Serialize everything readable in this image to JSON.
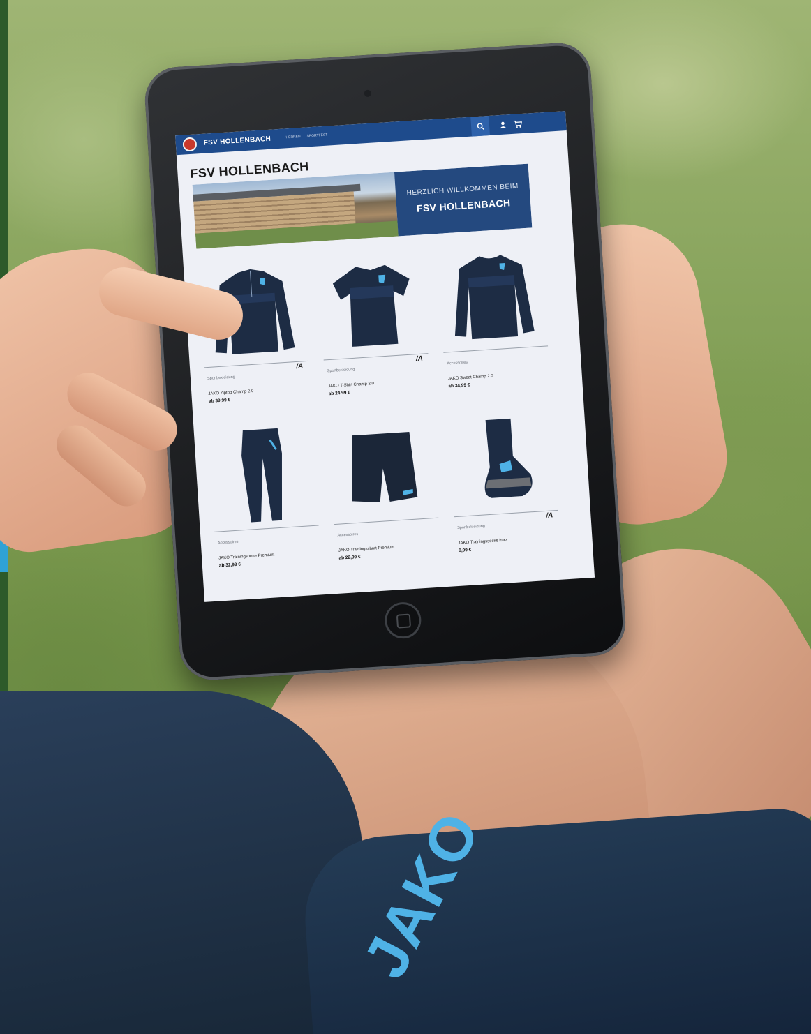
{
  "site": {
    "brand": "FSV HOLLENBACH",
    "nav": [
      "HERREN",
      "SPORTFEST"
    ],
    "page_title": "FSV HOLLENBACH",
    "banner_line1": "HERZLICH WILLKOMMEN BEIM",
    "banner_line2": "FSV HOLLENBACH"
  },
  "colors": {
    "header": "#1e4b8c",
    "banner_panel": "#24497f",
    "product_navy": "#1d2c44",
    "accent_blue": "#4fb2e6"
  },
  "icons": [
    "search-icon",
    "user-icon",
    "cart-icon",
    "club-crest-icon"
  ],
  "products": [
    {
      "category": "Sportbekleidung",
      "name": "JAKO Ziptop Champ 2.0",
      "price": "ab 39,99 €",
      "brand_logo": "/A",
      "icon": "jacket-icon"
    },
    {
      "category": "Sportbekleidung",
      "name": "JAKO T-Shirt Champ 2.0",
      "price": "ab 24,99 €",
      "brand_logo": "/A",
      "icon": "tshirt-icon"
    },
    {
      "category": "Accessoires",
      "name": "JAKO Sweat Champ 2.0",
      "price": "ab 34,99 €",
      "brand_logo": "",
      "icon": "sweater-icon"
    },
    {
      "category": "Accessoires",
      "name": "JAKO Trainingshose Premium",
      "price": "ab 32,99 €",
      "brand_logo": "",
      "icon": "pants-icon"
    },
    {
      "category": "Accessoires",
      "name": "JAKO Trainingsshort Premium",
      "price": "ab 22,99 €",
      "brand_logo": "",
      "icon": "shorts-icon"
    },
    {
      "category": "Sportbekleidung",
      "name": "JAKO Trainingssocke kurz",
      "price": "9,99 €",
      "brand_logo": "/A",
      "icon": "sock-icon"
    }
  ],
  "scene": {
    "shorts_print": "JAKO"
  }
}
